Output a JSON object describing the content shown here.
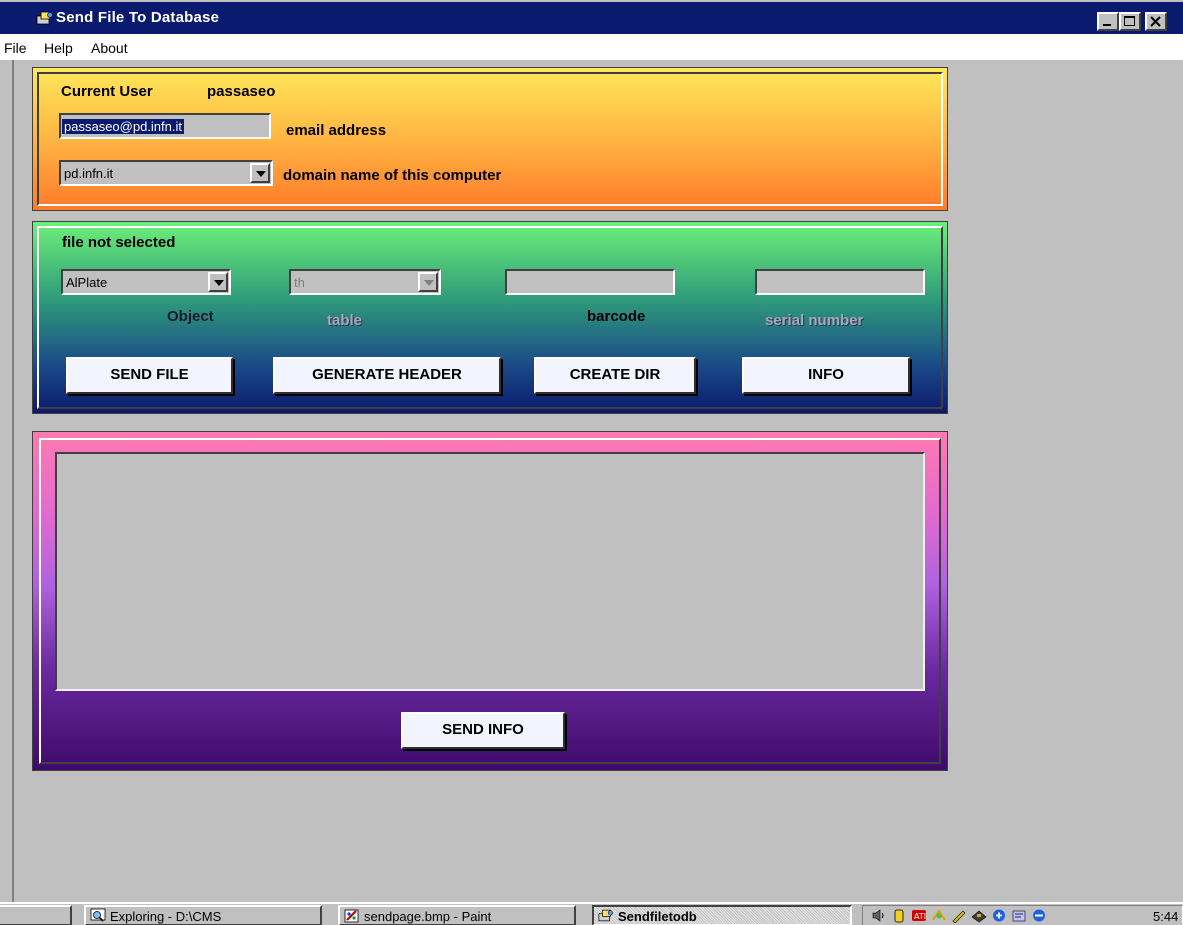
{
  "window": {
    "title": "Send File To Database"
  },
  "menu": {
    "items": [
      "File",
      "Help",
      "About"
    ]
  },
  "user_panel": {
    "current_user_label": "Current User",
    "current_user": "passaseo",
    "email_value": "passaseo@pd.infn.it",
    "email_label": "email address",
    "domain_value": "pd.infn.it",
    "domain_label": "domain name of this computer"
  },
  "file_panel": {
    "status": "file not selected",
    "object_value": "AlPlate",
    "object_label": "Object",
    "table_value": "th",
    "table_label": "table",
    "barcode_value": "",
    "barcode_label": "barcode",
    "serial_value": "",
    "serial_label": "serial number",
    "buttons": {
      "send_file": "SEND FILE",
      "generate_header": "GENERATE HEADER",
      "create_dir": "CREATE DIR",
      "info": "INFO"
    }
  },
  "info_panel": {
    "text": "",
    "send_info": "SEND INFO"
  },
  "taskbar": {
    "tasks": [
      {
        "label": "Exploring - D:\\CMS",
        "icon": "explorer-icon"
      },
      {
        "label": "sendpage.bmp - Paint",
        "icon": "paint-icon"
      },
      {
        "label": "Sendfiletodb",
        "icon": "app-icon",
        "active": true
      }
    ],
    "clock": "5:44"
  },
  "colors": {
    "titlebar": "#0a1a6e",
    "user_panel_top": "#ffe85a",
    "user_panel_bottom": "#ff7a2a",
    "file_panel_top": "#6ef07a",
    "file_panel_bottom": "#0c1a6e",
    "info_panel_top": "#ff7ab0",
    "info_panel_bottom": "#3e0a6a"
  }
}
